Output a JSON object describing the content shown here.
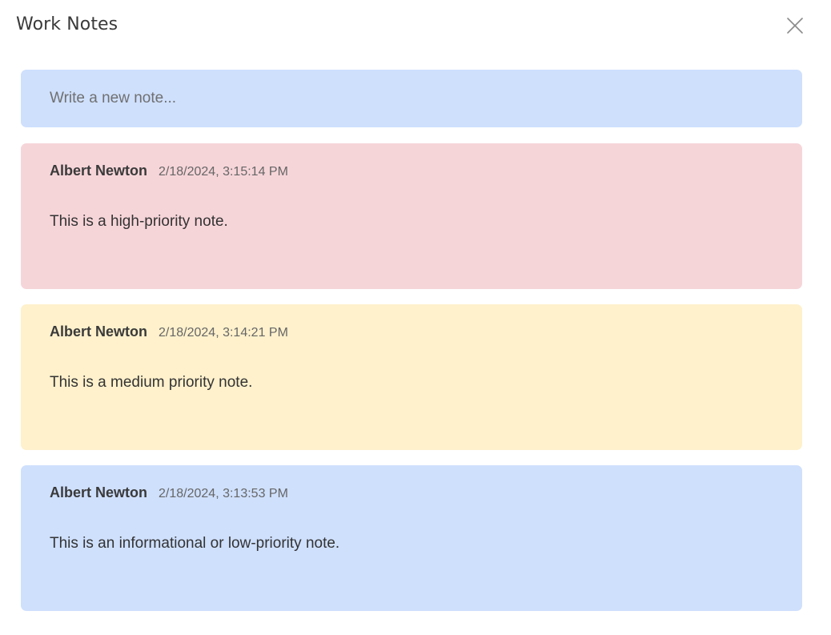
{
  "dialog": {
    "title": "Work Notes",
    "close_icon": "close-icon"
  },
  "new_note": {
    "placeholder": "Write a new note...",
    "value": ""
  },
  "colors": {
    "high_priority": "#f6d5d9",
    "medium_priority": "#fef1cc",
    "low_priority": "#cfe0fd",
    "input_background": "#cfe0fd"
  },
  "notes": [
    {
      "author": "Albert Newton",
      "timestamp": "2/18/2024, 3:15:14 PM",
      "text": "This is a high-priority note.",
      "priority": "high"
    },
    {
      "author": "Albert Newton",
      "timestamp": "2/18/2024, 3:14:21 PM",
      "text": "This is a medium priority note.",
      "priority": "medium"
    },
    {
      "author": "Albert Newton",
      "timestamp": "2/18/2024, 3:13:53 PM",
      "text": "This is an informational or low-priority note.",
      "priority": "low"
    }
  ]
}
